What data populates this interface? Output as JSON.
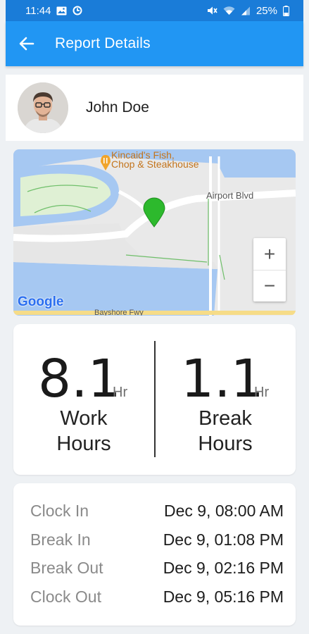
{
  "status_bar": {
    "time": "11:44",
    "battery": "25%",
    "icons": [
      "image-icon",
      "sync-icon",
      "mute-icon",
      "wifi-icon",
      "signal-icon",
      "battery-icon"
    ]
  },
  "app_bar": {
    "title": "Report Details",
    "back_icon": "arrow-back-icon",
    "color": "#2196f3"
  },
  "profile": {
    "name": "John Doe"
  },
  "map": {
    "poi_name_line1": "Kincaid's Fish,",
    "poi_name_line2": "Chop & Steakhouse",
    "road_label": "Airport Blvd",
    "bottom_road_label": "Bayshore Fwy",
    "logo": "Google",
    "zoom_in": "+",
    "zoom_out": "−",
    "marker_color": "#2db92d"
  },
  "hours": {
    "work": {
      "value": "8.1",
      "unit": "Hr",
      "label_line1": "Work",
      "label_line2": "Hours"
    },
    "break": {
      "value": "1.1",
      "unit": "Hr",
      "label_line1": "Break",
      "label_line2": "Hours"
    }
  },
  "times": [
    {
      "label": "Clock In",
      "value": "Dec 9, 08:00 AM"
    },
    {
      "label": "Break In",
      "value": "Dec 9, 01:08 PM"
    },
    {
      "label": "Break Out",
      "value": "Dec 9, 02:16 PM"
    },
    {
      "label": "Clock Out",
      "value": "Dec 9, 05:16 PM"
    }
  ]
}
